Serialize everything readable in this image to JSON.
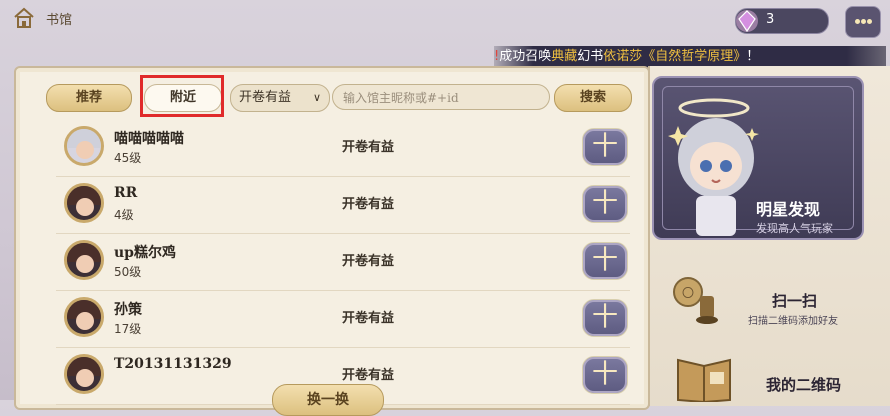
{
  "topbar": {
    "title": "书馆",
    "gem_count": "3"
  },
  "ticker": {
    "segments": [
      {
        "text": "!",
        "color": "red"
      },
      {
        "text": "成功召唤",
        "color": "white"
      },
      {
        "text": "典藏",
        "color": "gold"
      },
      {
        "text": "幻书",
        "color": "white"
      },
      {
        "text": "依诺莎《自然哲学原理》",
        "color": "gold"
      },
      {
        "text": "！",
        "color": "white"
      }
    ]
  },
  "tabs": {
    "recommend": "推荐",
    "nearby": "附近"
  },
  "filter": {
    "selected": "开卷有益",
    "chevron": "∨"
  },
  "search": {
    "placeholder": "输入馆主昵称或#+id",
    "button": "搜索"
  },
  "users": [
    {
      "name": "喵喵喵喵喵",
      "level": "45级",
      "tag": "开卷有益"
    },
    {
      "name": "RR",
      "level": "4级",
      "tag": "开卷有益"
    },
    {
      "name": "up糕尔鸡",
      "level": "50级",
      "tag": "开卷有益"
    },
    {
      "name": "孙策",
      "level": "17级",
      "tag": "开卷有益"
    },
    {
      "name": "T20131131329",
      "level": "",
      "tag": "开卷有益"
    }
  ],
  "add_symbol": "十",
  "refresh_label": "换一换",
  "side": {
    "star_title": "明星发现",
    "star_sub": "发现高人气玩家",
    "scan_title": "扫一扫",
    "scan_sub": "扫描二维码添加好友",
    "qr_title": "我的二维码"
  }
}
